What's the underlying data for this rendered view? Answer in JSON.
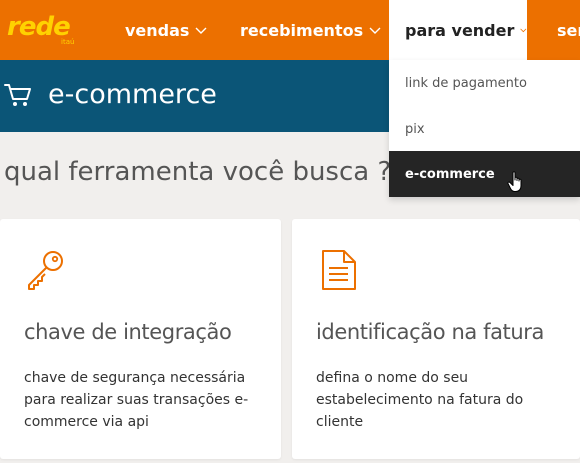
{
  "nav": {
    "logo_text": "rede",
    "logo_sub": "itaú",
    "items": [
      {
        "label": "vendas"
      },
      {
        "label": "recebimentos"
      },
      {
        "label": "para vender"
      },
      {
        "label": "ser"
      }
    ]
  },
  "dropdown": {
    "items": [
      {
        "label": "link de pagamento"
      },
      {
        "label": "pix"
      },
      {
        "label": "e-commerce"
      }
    ]
  },
  "page": {
    "title": "e-commerce",
    "question": "qual ferramenta você busca ?"
  },
  "cards": [
    {
      "title": "chave de integração",
      "description": "chave de segurança necessária para realizar suas transações e-commerce via api",
      "icon": "key-icon"
    },
    {
      "title": "identificação na fatura",
      "description": "defina o nome do seu estabelecimento na fatura do cliente",
      "icon": "document-icon"
    }
  ],
  "colors": {
    "brand_orange": "#ec7000",
    "brand_yellow": "#ffd200",
    "title_bar": "#0b5577",
    "dropdown_active": "#252525"
  }
}
